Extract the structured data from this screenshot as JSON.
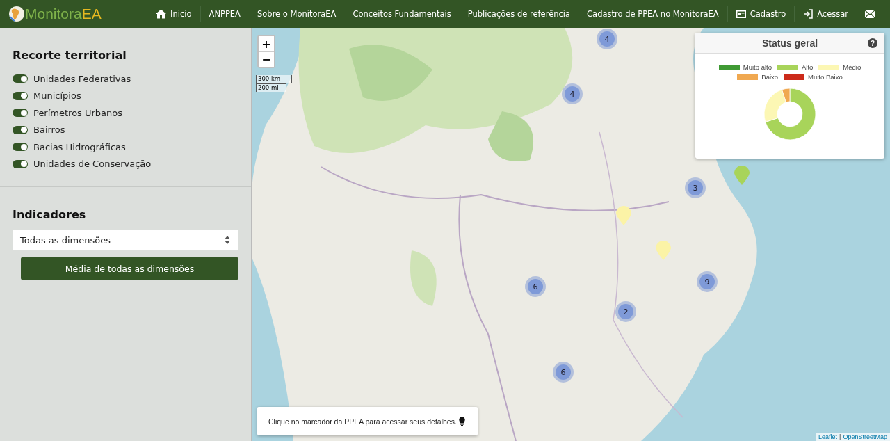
{
  "header": {
    "logo": {
      "part_1": "Monitora",
      "part_2": "EA"
    },
    "nav": [
      {
        "kind": "home",
        "label": "Inicio"
      },
      {
        "kind": "text",
        "label": "ANPPEA"
      },
      {
        "kind": "text",
        "label": "Sobre o MonitoraEA"
      },
      {
        "kind": "text",
        "label": "Conceitos Fundamentais"
      },
      {
        "kind": "text",
        "label": "Publicações de referência"
      },
      {
        "kind": "text",
        "label": "Cadastro de PPEA no MonitoraEA"
      },
      {
        "kind": "card",
        "label": "Cadastro"
      },
      {
        "kind": "login",
        "label": "Acessar"
      },
      {
        "kind": "mail"
      }
    ]
  },
  "sidebar": {
    "territory": {
      "title": "Recorte territorial",
      "layers": [
        {
          "label": "Unidades Federativas",
          "on": true
        },
        {
          "label": "Municípios",
          "on": true
        },
        {
          "label": "Perímetros Urbanos",
          "on": true
        },
        {
          "label": "Bairros",
          "on": true
        },
        {
          "label": "Bacias Hidrográficas",
          "on": true
        },
        {
          "label": "Unidades de Conservação",
          "on": true
        }
      ]
    },
    "indicators": {
      "title": "Indicadores",
      "select": {
        "value": "Todas as dimensões"
      },
      "button": "Média de todas as dimensões"
    }
  },
  "map": {
    "zoom_in": "+",
    "zoom_out": "−",
    "scale": [
      "300 km",
      "200 mi"
    ],
    "markers": [
      {
        "kind": "cluster",
        "count": "4"
      },
      {
        "kind": "cluster",
        "count": "4"
      },
      {
        "kind": "cluster",
        "count": "3"
      },
      {
        "kind": "cluster",
        "count": "6"
      },
      {
        "kind": "cluster",
        "count": "9"
      },
      {
        "kind": "cluster",
        "count": "2"
      },
      {
        "kind": "cluster",
        "count": "6"
      },
      {
        "kind": "pin",
        "color": "#a8d45a"
      },
      {
        "kind": "pin",
        "color": "#fbf3a6"
      },
      {
        "kind": "pin",
        "color": "#fbf3a6"
      }
    ],
    "info": "Clique no marcador da PPEA para acessar seus detalhes.",
    "attribution": {
      "links": [
        "Leaflet",
        "OpenStreetMap"
      ],
      "separator": "|"
    }
  },
  "status_panel": {
    "title": "Status geral",
    "help": "?",
    "legend": [
      {
        "label": "Muito alto",
        "color": "#3f9a34"
      },
      {
        "label": "Alto",
        "color": "#a8d45a"
      },
      {
        "label": "Médio",
        "color": "#fcf7b4"
      },
      {
        "label": "Baixo",
        "color": "#f0a850"
      },
      {
        "label": "Muito Baixo",
        "color": "#cc2a1a"
      }
    ]
  }
}
